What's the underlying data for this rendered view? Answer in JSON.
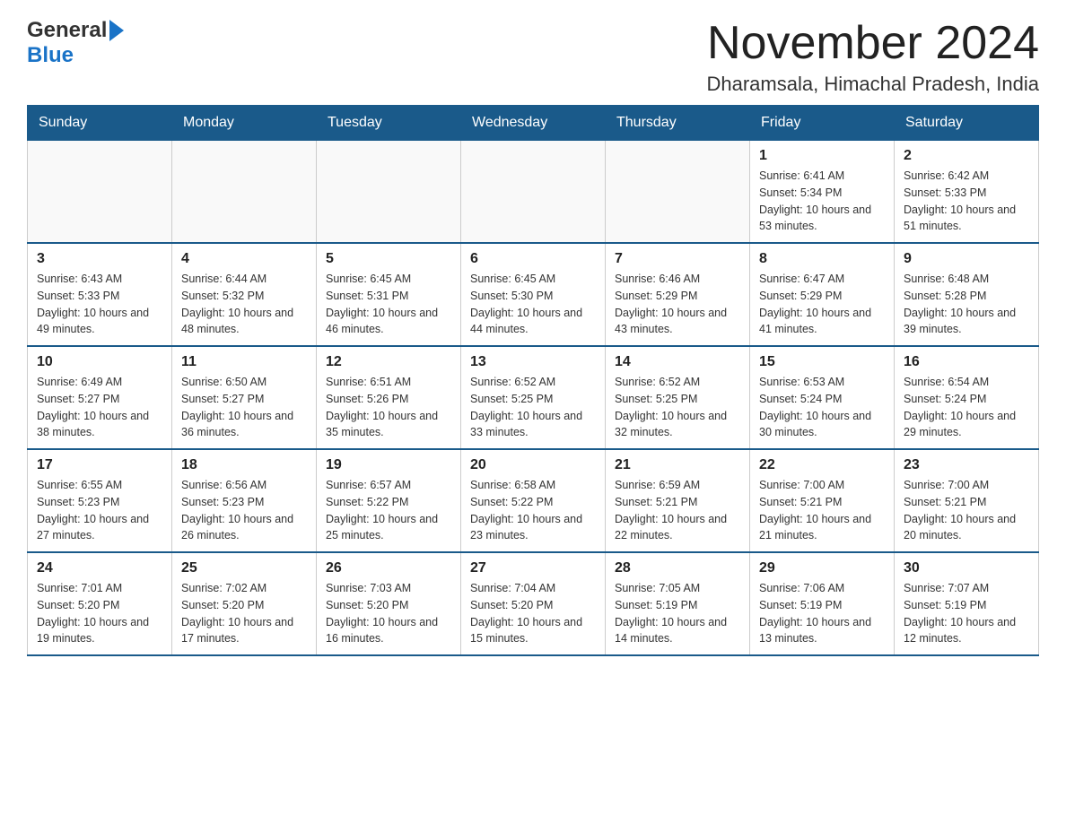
{
  "logo": {
    "general": "General",
    "blue": "Blue"
  },
  "title": "November 2024",
  "subtitle": "Dharamsala, Himachal Pradesh, India",
  "weekdays": [
    "Sunday",
    "Monday",
    "Tuesday",
    "Wednesday",
    "Thursday",
    "Friday",
    "Saturday"
  ],
  "weeks": [
    [
      {
        "day": "",
        "sunrise": "",
        "sunset": "",
        "daylight": ""
      },
      {
        "day": "",
        "sunrise": "",
        "sunset": "",
        "daylight": ""
      },
      {
        "day": "",
        "sunrise": "",
        "sunset": "",
        "daylight": ""
      },
      {
        "day": "",
        "sunrise": "",
        "sunset": "",
        "daylight": ""
      },
      {
        "day": "",
        "sunrise": "",
        "sunset": "",
        "daylight": ""
      },
      {
        "day": "1",
        "sunrise": "Sunrise: 6:41 AM",
        "sunset": "Sunset: 5:34 PM",
        "daylight": "Daylight: 10 hours and 53 minutes."
      },
      {
        "day": "2",
        "sunrise": "Sunrise: 6:42 AM",
        "sunset": "Sunset: 5:33 PM",
        "daylight": "Daylight: 10 hours and 51 minutes."
      }
    ],
    [
      {
        "day": "3",
        "sunrise": "Sunrise: 6:43 AM",
        "sunset": "Sunset: 5:33 PM",
        "daylight": "Daylight: 10 hours and 49 minutes."
      },
      {
        "day": "4",
        "sunrise": "Sunrise: 6:44 AM",
        "sunset": "Sunset: 5:32 PM",
        "daylight": "Daylight: 10 hours and 48 minutes."
      },
      {
        "day": "5",
        "sunrise": "Sunrise: 6:45 AM",
        "sunset": "Sunset: 5:31 PM",
        "daylight": "Daylight: 10 hours and 46 minutes."
      },
      {
        "day": "6",
        "sunrise": "Sunrise: 6:45 AM",
        "sunset": "Sunset: 5:30 PM",
        "daylight": "Daylight: 10 hours and 44 minutes."
      },
      {
        "day": "7",
        "sunrise": "Sunrise: 6:46 AM",
        "sunset": "Sunset: 5:29 PM",
        "daylight": "Daylight: 10 hours and 43 minutes."
      },
      {
        "day": "8",
        "sunrise": "Sunrise: 6:47 AM",
        "sunset": "Sunset: 5:29 PM",
        "daylight": "Daylight: 10 hours and 41 minutes."
      },
      {
        "day": "9",
        "sunrise": "Sunrise: 6:48 AM",
        "sunset": "Sunset: 5:28 PM",
        "daylight": "Daylight: 10 hours and 39 minutes."
      }
    ],
    [
      {
        "day": "10",
        "sunrise": "Sunrise: 6:49 AM",
        "sunset": "Sunset: 5:27 PM",
        "daylight": "Daylight: 10 hours and 38 minutes."
      },
      {
        "day": "11",
        "sunrise": "Sunrise: 6:50 AM",
        "sunset": "Sunset: 5:27 PM",
        "daylight": "Daylight: 10 hours and 36 minutes."
      },
      {
        "day": "12",
        "sunrise": "Sunrise: 6:51 AM",
        "sunset": "Sunset: 5:26 PM",
        "daylight": "Daylight: 10 hours and 35 minutes."
      },
      {
        "day": "13",
        "sunrise": "Sunrise: 6:52 AM",
        "sunset": "Sunset: 5:25 PM",
        "daylight": "Daylight: 10 hours and 33 minutes."
      },
      {
        "day": "14",
        "sunrise": "Sunrise: 6:52 AM",
        "sunset": "Sunset: 5:25 PM",
        "daylight": "Daylight: 10 hours and 32 minutes."
      },
      {
        "day": "15",
        "sunrise": "Sunrise: 6:53 AM",
        "sunset": "Sunset: 5:24 PM",
        "daylight": "Daylight: 10 hours and 30 minutes."
      },
      {
        "day": "16",
        "sunrise": "Sunrise: 6:54 AM",
        "sunset": "Sunset: 5:24 PM",
        "daylight": "Daylight: 10 hours and 29 minutes."
      }
    ],
    [
      {
        "day": "17",
        "sunrise": "Sunrise: 6:55 AM",
        "sunset": "Sunset: 5:23 PM",
        "daylight": "Daylight: 10 hours and 27 minutes."
      },
      {
        "day": "18",
        "sunrise": "Sunrise: 6:56 AM",
        "sunset": "Sunset: 5:23 PM",
        "daylight": "Daylight: 10 hours and 26 minutes."
      },
      {
        "day": "19",
        "sunrise": "Sunrise: 6:57 AM",
        "sunset": "Sunset: 5:22 PM",
        "daylight": "Daylight: 10 hours and 25 minutes."
      },
      {
        "day": "20",
        "sunrise": "Sunrise: 6:58 AM",
        "sunset": "Sunset: 5:22 PM",
        "daylight": "Daylight: 10 hours and 23 minutes."
      },
      {
        "day": "21",
        "sunrise": "Sunrise: 6:59 AM",
        "sunset": "Sunset: 5:21 PM",
        "daylight": "Daylight: 10 hours and 22 minutes."
      },
      {
        "day": "22",
        "sunrise": "Sunrise: 7:00 AM",
        "sunset": "Sunset: 5:21 PM",
        "daylight": "Daylight: 10 hours and 21 minutes."
      },
      {
        "day": "23",
        "sunrise": "Sunrise: 7:00 AM",
        "sunset": "Sunset: 5:21 PM",
        "daylight": "Daylight: 10 hours and 20 minutes."
      }
    ],
    [
      {
        "day": "24",
        "sunrise": "Sunrise: 7:01 AM",
        "sunset": "Sunset: 5:20 PM",
        "daylight": "Daylight: 10 hours and 19 minutes."
      },
      {
        "day": "25",
        "sunrise": "Sunrise: 7:02 AM",
        "sunset": "Sunset: 5:20 PM",
        "daylight": "Daylight: 10 hours and 17 minutes."
      },
      {
        "day": "26",
        "sunrise": "Sunrise: 7:03 AM",
        "sunset": "Sunset: 5:20 PM",
        "daylight": "Daylight: 10 hours and 16 minutes."
      },
      {
        "day": "27",
        "sunrise": "Sunrise: 7:04 AM",
        "sunset": "Sunset: 5:20 PM",
        "daylight": "Daylight: 10 hours and 15 minutes."
      },
      {
        "day": "28",
        "sunrise": "Sunrise: 7:05 AM",
        "sunset": "Sunset: 5:19 PM",
        "daylight": "Daylight: 10 hours and 14 minutes."
      },
      {
        "day": "29",
        "sunrise": "Sunrise: 7:06 AM",
        "sunset": "Sunset: 5:19 PM",
        "daylight": "Daylight: 10 hours and 13 minutes."
      },
      {
        "day": "30",
        "sunrise": "Sunrise: 7:07 AM",
        "sunset": "Sunset: 5:19 PM",
        "daylight": "Daylight: 10 hours and 12 minutes."
      }
    ]
  ]
}
